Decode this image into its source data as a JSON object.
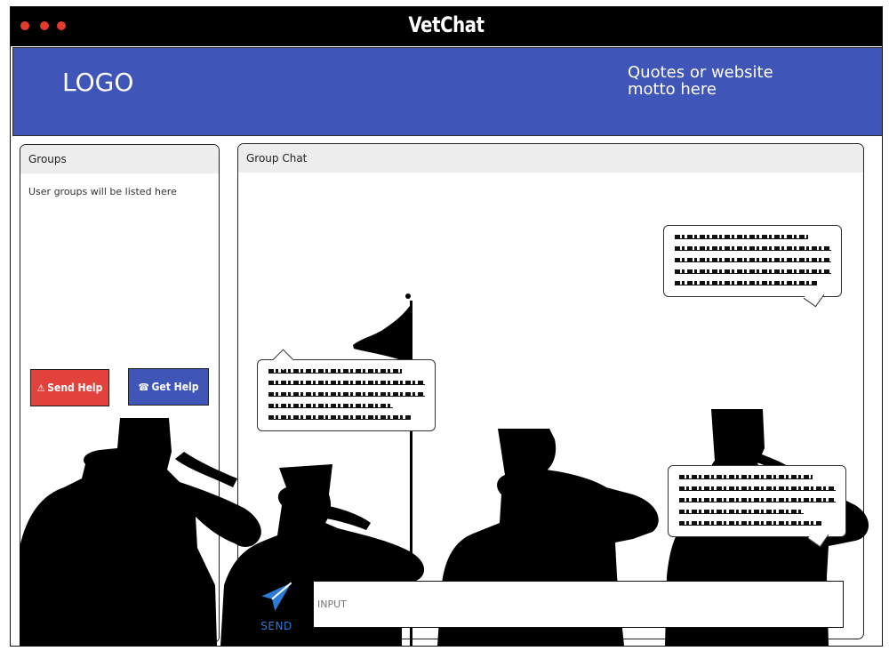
{
  "window": {
    "title": "VetChat",
    "controls": [
      "close-dot",
      "minimize-dot",
      "maximize-dot"
    ]
  },
  "header": {
    "logo_text": "LOGO",
    "motto_line1": "Quotes or website",
    "motto_line2": "motto here"
  },
  "groups": {
    "title": "Groups",
    "empty_text": "User groups will be listed here",
    "send_help_label": "Send Help",
    "send_help_icon": "warning-icon",
    "get_help_label": "Get Help",
    "get_help_icon": "phone-icon"
  },
  "chat": {
    "title": "Group Chat",
    "send_label": "SEND",
    "input_placeholder": "INPUT"
  },
  "colors": {
    "titlebar": "#000000",
    "header": "#4055b8",
    "send_help": "#e3413b",
    "get_help": "#4055b8",
    "accent": "#2c7bd6",
    "window_dots": "#e53b2f"
  }
}
